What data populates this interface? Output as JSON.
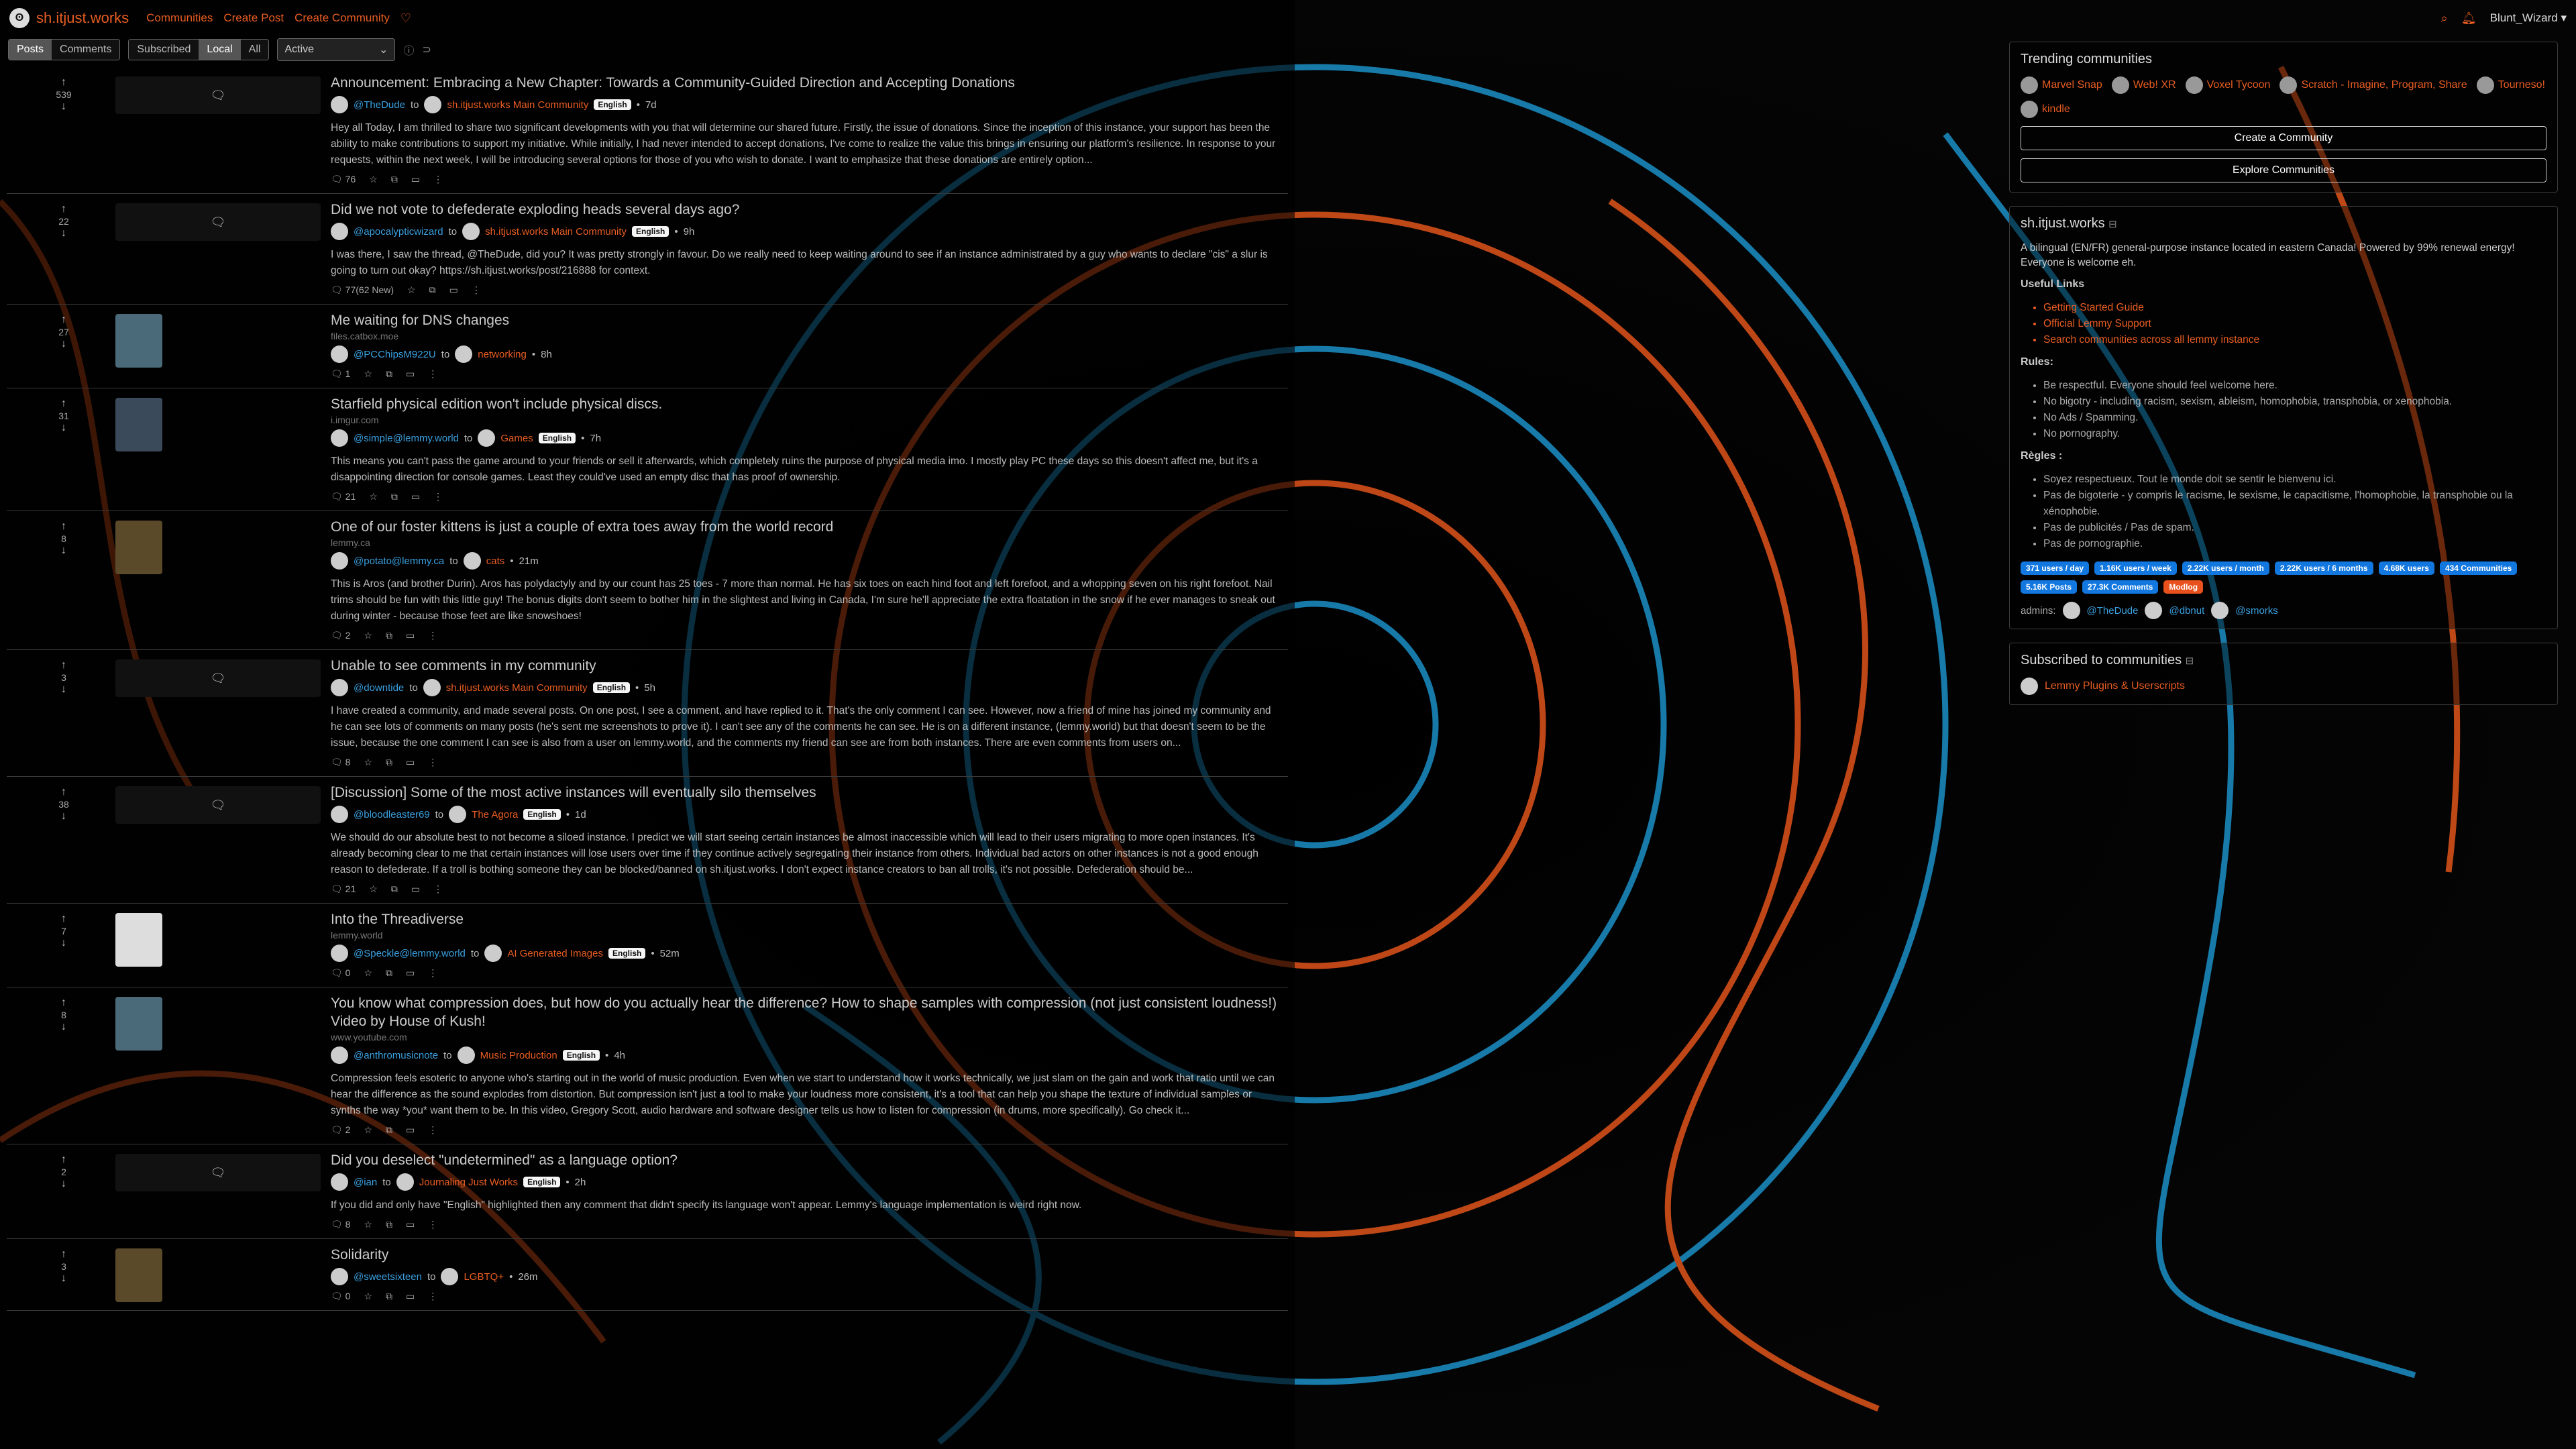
{
  "nav": {
    "brand": "sh.itjust.works",
    "links": [
      "Communities",
      "Create Post",
      "Create Community"
    ],
    "username": "Blunt_Wizard",
    "accent": "#e85d22"
  },
  "filters": {
    "type": [
      "Posts",
      "Comments"
    ],
    "listing": [
      "Subscribed",
      "Local",
      "All"
    ],
    "sort": "Active",
    "active_type": "Posts",
    "active_listing": "Local"
  },
  "posts": [
    {
      "score": "539",
      "title": "Announcement: Embracing a New Chapter: Towards a Community-Guided Direction and Accepting Donations",
      "domain": "",
      "user": "@TheDude",
      "community": "sh.itjust.works Main Community",
      "lang": "English",
      "time": "7d",
      "snippet": "Hey all Today, I am thrilled to share two significant developments with you that will determine our shared future. Firstly, the issue of donations. Since the inception of this instance, your support has been the ability to make contributions to support my initiative. While initially, I had never intended to accept donations, I've come to realize the value this brings in ensuring our platform's resilience. In response to your requests, within the next week, I will be introducing several options for those of you who wish to donate. I want to emphasize that these donations are entirely option...",
      "comments": "76",
      "thumb": "chat"
    },
    {
      "score": "22",
      "title": "Did we not vote to defederate exploding heads several days ago?",
      "domain": "",
      "user": "@apocalypticwizard",
      "community": "sh.itjust.works Main Community",
      "lang": "English",
      "time": "9h",
      "snippet": "I was there, I saw the thread, @TheDude, did you? It was pretty strongly in favour. Do we really need to keep waiting around to see if an instance administrated by a guy who wants to declare \"cis\" a slur is going to turn out okay? https://sh.itjust.works/post/216888 for context.",
      "comments": "77(62 New)",
      "thumb": "chat"
    },
    {
      "score": "27",
      "title": "Me waiting for DNS changes",
      "domain": "files.catbox.moe",
      "user": "@PCChipsM922U",
      "community": "networking",
      "lang": "",
      "time": "8h",
      "snippet": "",
      "comments": "1",
      "thumb": "image"
    },
    {
      "score": "31",
      "title": "Starfield physical edition won't include physical discs.",
      "domain": "i.imgur.com",
      "user": "@simple@lemmy.world",
      "community": "Games",
      "lang": "English",
      "time": "7h",
      "snippet": "This means you can't pass the game around to your friends or sell it afterwards, which completely ruins the purpose of physical media imo. I mostly play PC these days so this doesn't affect me, but it's a disappointing direction for console games. Least they could've used an empty disc that has proof of ownership.",
      "comments": "21",
      "thumb": "image"
    },
    {
      "score": "8",
      "title": "One of our foster kittens is just a couple of extra toes away from the world record",
      "domain": "lemmy.ca",
      "user": "@potato@lemmy.ca",
      "community": "cats",
      "lang": "",
      "time": "21m",
      "snippet": "This is Aros (and brother Durin). Aros has polydactyly and by our count has 25 toes - 7 more than normal. He has six toes on each hind foot and left forefoot, and a whopping seven on his right forefoot. Nail trims should be fun with this little guy! The bonus digits don't seem to bother him in the slightest and living in Canada, I'm sure he'll appreciate the extra floatation in the snow if he ever manages to sneak out during winter - because those feet are like snowshoes!",
      "comments": "2",
      "thumb": "image"
    },
    {
      "score": "3",
      "title": "Unable to see comments in my community",
      "domain": "",
      "user": "@downtide",
      "community": "sh.itjust.works Main Community",
      "lang": "English",
      "time": "5h",
      "snippet": "I have created a community, and made several posts. On one post, I see a comment, and have replied to it. That's the only comment I can see. However, now a friend of mine has joined my community and he can see lots of comments on many posts (he's sent me screenshots to prove it). I can't see any of the comments he can see. He is on a different instance, (lemmy.world) but that doesn't seem to be the issue, because the one comment I can see is also from a user on lemmy.world, and the comments my friend can see are from both instances. There are even comments from users on...",
      "comments": "8",
      "thumb": "chat"
    },
    {
      "score": "38",
      "title": "[Discussion] Some of the most active instances will eventually silo themselves",
      "domain": "",
      "user": "@bloodleaster69",
      "community": "The Agora",
      "lang": "English",
      "time": "1d",
      "snippet": "We should do our absolute best to not become a siloed instance. I predict we will start seeing certain instances be almost inaccessible which will lead to their users migrating to more open instances. It's already becoming clear to me that certain instances will lose users over time if they continue actively segregating their instance from others. Individual bad actors on other instances is not a good enough reason to defederate. If a troll is bothing someone they can be blocked/banned on sh.itjust.works. I don't expect instance creators to ban all trolls, it's not possible. Defederation should be...",
      "comments": "21",
      "thumb": "chat"
    },
    {
      "score": "7",
      "title": "Into the Threadiverse",
      "domain": "lemmy.world",
      "user": "@Speckle@lemmy.world",
      "community": "AI Generated Images",
      "lang": "English",
      "time": "52m",
      "snippet": "",
      "comments": "0",
      "thumb": "image"
    },
    {
      "score": "8",
      "title": "You know what compression does, but how do you actually hear the difference? How to shape samples with compression (not just consistent loudness!) Video by House of Kush!",
      "domain": "www.youtube.com",
      "user": "@anthromusicnote",
      "community": "Music Production",
      "lang": "English",
      "time": "4h",
      "snippet": "Compression feels esoteric to anyone who's starting out in the world of music production. Even when we start to understand how it works technically, we just slam on the gain and work that ratio until we can hear the difference as the sound explodes from distortion. But compression isn't just a tool to make your loudness more consistent, it's a tool that can help you shape the texture of individual samples or synths the way *you* want them to be. In this video, Gregory Scott, audio hardware and software designer tells us how to listen for compression (in drums, more specifically). Go check it...",
      "comments": "2",
      "thumb": "image"
    },
    {
      "score": "2",
      "title": "Did you deselect \"undetermined\" as a language option?",
      "domain": "",
      "user": "@ian",
      "community": "Journaling Just Works",
      "lang": "English",
      "time": "2h",
      "snippet": "If you did and only have \"English\" highlighted then any comment that didn't specify its language won't appear. Lemmy's language implementation is weird right now.",
      "comments": "8",
      "thumb": "chat"
    },
    {
      "score": "3",
      "title": "Solidarity",
      "domain": "",
      "user": "@sweetsixteen",
      "community": "LGBTQ+",
      "lang": "",
      "time": "26m",
      "snippet": "",
      "comments": "0",
      "thumb": "image"
    }
  ],
  "sidebar": {
    "trending_title": "Trending communities",
    "trending": [
      "Marvel Snap",
      "Web! XR",
      "Voxel Tycoon",
      "Scratch - Imagine, Program, Share",
      "Tourneso!",
      "kindle"
    ],
    "create_btn": "Create a Community",
    "explore_btn": "Explore Communities",
    "instance_title": "sh.itjust.works",
    "instance_desc": "A bilingual (EN/FR) general-purpose instance located in eastern Canada! Powered by 99% renewal energy! Everyone is welcome eh.",
    "useful_links_title": "Useful Links",
    "useful_links": [
      "Getting Started Guide",
      "Official Lemmy Support",
      "Search communities across all lemmy instance"
    ],
    "rules_title": "Rules:",
    "rules": [
      "Be respectful. Everyone should feel welcome here.",
      "No bigotry - including racism, sexism, ableism, homophobia, transphobia, or xenophobia.",
      "No Ads / Spamming.",
      "No pornography."
    ],
    "regles_title": "Règles :",
    "regles": [
      "Soyez respectueux. Tout le monde doit se sentir le bienvenu ici.",
      "Pas de bigoterie - y compris le racisme, le sexisme, le capacitisme, l'homophobie, la transphobie ou la xénophobie.",
      "Pas de publicités / Pas de spam.",
      "Pas de pornographie."
    ],
    "stats": [
      "371 users / day",
      "1.16K users / week",
      "2.22K users / month",
      "2.22K users / 6 months",
      "4.68K users",
      "434 Communities",
      "5.16K Posts",
      "27.3K Comments",
      "Modlog"
    ],
    "admins_label": "admins:",
    "admins": [
      "@TheDude",
      "@dbnut",
      "@smorks"
    ],
    "subscribed_title": "Subscribed to communities",
    "subscribed": [
      "Lemmy Plugins & Userscripts"
    ],
    "stat_color": "#1278e0",
    "warn_color": "#e8501d"
  }
}
